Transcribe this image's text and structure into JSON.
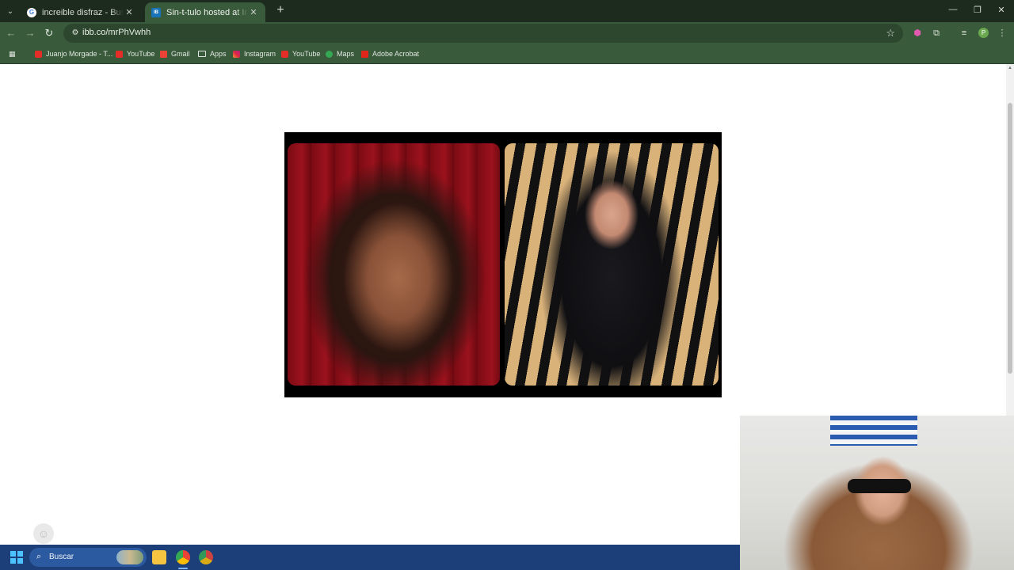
{
  "tabs": [
    {
      "title": "increible disfraz - Buscar con Google",
      "active": false
    },
    {
      "title": "Sin-t-tulo hosted at ImgBB — ImgBB",
      "active": true
    }
  ],
  "address_bar": {
    "url": "ibb.co/mrPhVwhh"
  },
  "profile_initial": "P",
  "bookmarks": [
    {
      "label": "Juanjo Morgade - T...",
      "icon": "youtube-icon"
    },
    {
      "label": "YouTube",
      "icon": "youtube-icon"
    },
    {
      "label": "Gmail",
      "icon": "gmail-icon"
    },
    {
      "label": "Apps",
      "icon": "folder-icon"
    },
    {
      "label": "Instagram",
      "icon": "instagram-icon"
    },
    {
      "label": "YouTube",
      "icon": "youtube-icon"
    },
    {
      "label": "Maps",
      "icon": "maps-icon"
    },
    {
      "label": "Adobe Acrobat",
      "icon": "acrobat-icon"
    }
  ],
  "taskbar": {
    "search_placeholder": "Buscar"
  },
  "colors": {
    "chrome_dark": "#1d2a1e",
    "chrome_green": "#3a5a3c",
    "taskbar_blue": "#1c3f7a"
  }
}
